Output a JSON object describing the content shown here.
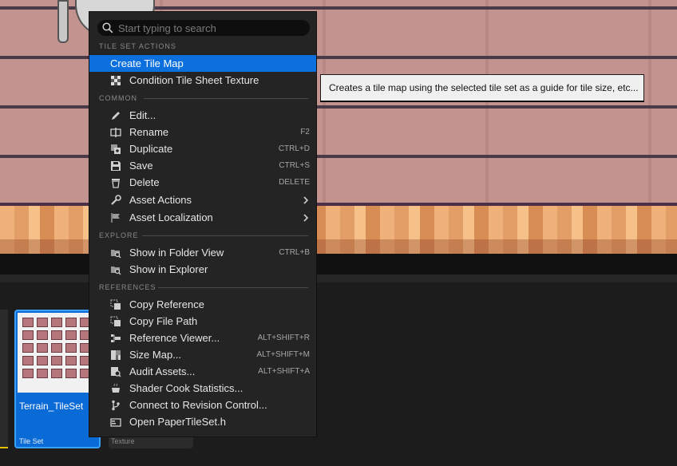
{
  "menu": {
    "search_placeholder": "Start typing to search",
    "sections": {
      "tile_set_actions": "TILE SET ACTIONS",
      "common": "COMMON",
      "explore": "EXPLORE",
      "references": "REFERENCES"
    },
    "items": {
      "create_tile_map": {
        "label": "Create Tile Map"
      },
      "condition_texture": {
        "label": "Condition Tile Sheet Texture",
        "icon": "checker-icon"
      },
      "edit": {
        "label": "Edit...",
        "icon": "pencil-icon"
      },
      "rename": {
        "label": "Rename",
        "shortcut": "F2",
        "icon": "rename-icon"
      },
      "duplicate": {
        "label": "Duplicate",
        "shortcut": "CTRL+D",
        "icon": "duplicate-icon"
      },
      "save": {
        "label": "Save",
        "shortcut": "CTRL+S",
        "icon": "save-icon"
      },
      "delete": {
        "label": "Delete",
        "shortcut": "DELETE",
        "icon": "trash-icon"
      },
      "asset_actions": {
        "label": "Asset Actions",
        "icon": "wrench-icon"
      },
      "asset_localization": {
        "label": "Asset Localization",
        "icon": "flag-icon"
      },
      "show_folder_view": {
        "label": "Show in Folder View",
        "shortcut": "CTRL+B",
        "icon": "folder-search-icon"
      },
      "show_explorer": {
        "label": "Show in Explorer",
        "icon": "folder-search-icon"
      },
      "copy_reference": {
        "label": "Copy Reference",
        "icon": "copy-icon"
      },
      "copy_file_path": {
        "label": "Copy File Path",
        "icon": "copy-icon"
      },
      "reference_viewer": {
        "label": "Reference Viewer...",
        "shortcut": "ALT+SHIFT+R",
        "icon": "reference-graph-icon"
      },
      "size_map": {
        "label": "Size Map...",
        "shortcut": "ALT+SHIFT+M",
        "icon": "size-map-icon"
      },
      "audit_assets": {
        "label": "Audit Assets...",
        "shortcut": "ALT+SHIFT+A",
        "icon": "audit-icon"
      },
      "shader_cook": {
        "label": "Shader Cook Statistics...",
        "icon": "pot-icon"
      },
      "revision_control": {
        "label": "Connect to Revision Control...",
        "icon": "branch-icon"
      },
      "open_header": {
        "label": "Open PaperTileSet.h",
        "icon": "code-file-icon"
      }
    }
  },
  "tooltip": {
    "text": "Creates a tile map using the selected tile set as a guide for tile size, etc..."
  },
  "assets": [
    {
      "name": "Terrain_TileSet",
      "type": "Tile Set"
    },
    {
      "name": "",
      "type": "Texture"
    }
  ],
  "colors": {
    "highlight": "#0b70de",
    "menu_bg": "#242424",
    "selected_tile": "#0a6ad6"
  }
}
